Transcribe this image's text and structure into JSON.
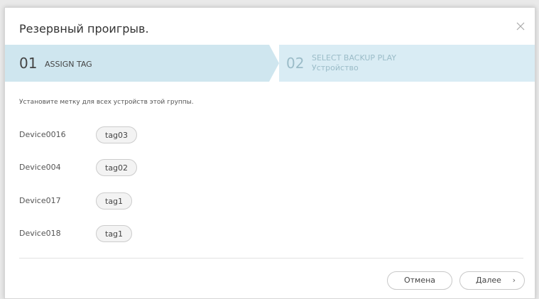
{
  "dialog": {
    "title": "Резервный проигрыв.",
    "close_icon": "close-icon"
  },
  "steps": [
    {
      "number": "01",
      "label": "ASSIGN TAG",
      "active": true
    },
    {
      "number": "02",
      "label": "SELECT BACKUP PLAY",
      "sublabel": "Устройство",
      "active": false
    }
  ],
  "hint": "Установите метку для всех устройств этой группы.",
  "devices": [
    {
      "name": "Device0016",
      "tag": "tag03"
    },
    {
      "name": "Device004",
      "tag": "tag02"
    },
    {
      "name": "Device017",
      "tag": "tag1"
    },
    {
      "name": "Device018",
      "tag": "tag1"
    }
  ],
  "buttons": {
    "cancel": "Отмена",
    "next": "Далее",
    "next_icon": "chevron-right-icon"
  }
}
